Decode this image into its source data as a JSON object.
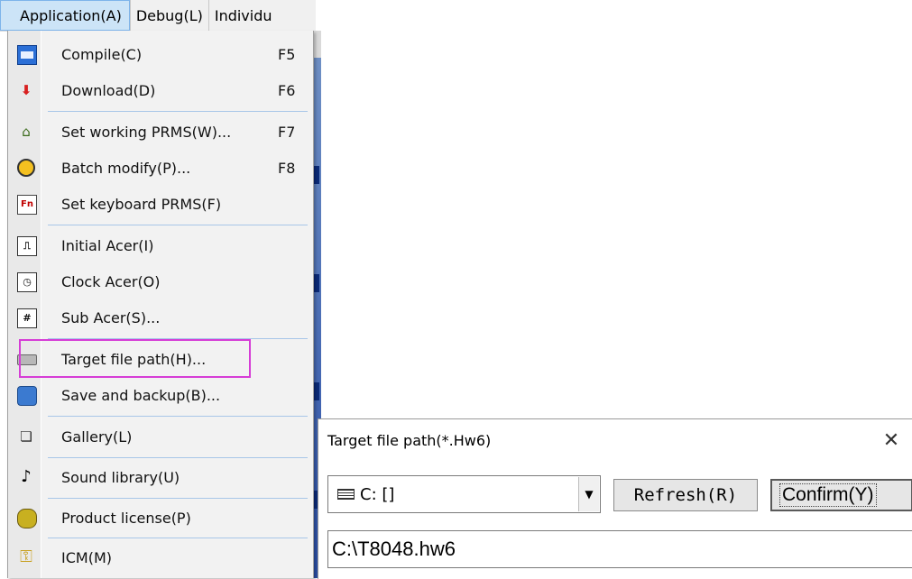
{
  "menubar": {
    "items": [
      "Application(A)",
      "Debug(L)",
      "Individu"
    ]
  },
  "menu": {
    "items": [
      {
        "label": "Compile(C)",
        "shortcut": "F5",
        "icon": "compile-icon"
      },
      {
        "label": "Download(D)",
        "shortcut": "F6",
        "icon": "download-icon"
      },
      {
        "label": "Set working PRMS(W)...",
        "shortcut": "F7",
        "icon": "home-icon"
      },
      {
        "label": "Batch modify(P)...",
        "shortcut": "F8",
        "icon": "batch-icon"
      },
      {
        "label": "Set keyboard PRMS(F)",
        "shortcut": "",
        "icon": "fn-key-icon"
      },
      {
        "label": "Initial Acer(I)",
        "shortcut": "",
        "icon": "initial-icon"
      },
      {
        "label": "Clock Acer(O)",
        "shortcut": "",
        "icon": "clock-icon"
      },
      {
        "label": "Sub Acer(S)...",
        "shortcut": "",
        "icon": "hash-icon"
      },
      {
        "label": "Target file path(H)...",
        "shortcut": "",
        "icon": "disk-icon",
        "highlighted": true
      },
      {
        "label": "Save and backup(B)...",
        "shortcut": "",
        "icon": "save-icon"
      },
      {
        "label": "Gallery(L)",
        "shortcut": "",
        "icon": "gallery-icon"
      },
      {
        "label": "Sound library(U)",
        "shortcut": "",
        "icon": "music-note-icon"
      },
      {
        "label": "Product license(P)",
        "shortcut": "",
        "icon": "license-icon"
      },
      {
        "label": "ICM(M)",
        "shortcut": "",
        "icon": "key-icon"
      }
    ]
  },
  "dialog": {
    "title": "Target file path(*.Hw6)",
    "close": "✕",
    "drive_value": "C: []",
    "refresh_label": "Refresh(R)",
    "confirm_label": "Confirm(Y)",
    "path_value": "C:\\T8048.hw6"
  },
  "colors": {
    "highlight_border": "#d63dd6",
    "menu_active": "#cce4f7",
    "separator": "#a8c6e8"
  }
}
